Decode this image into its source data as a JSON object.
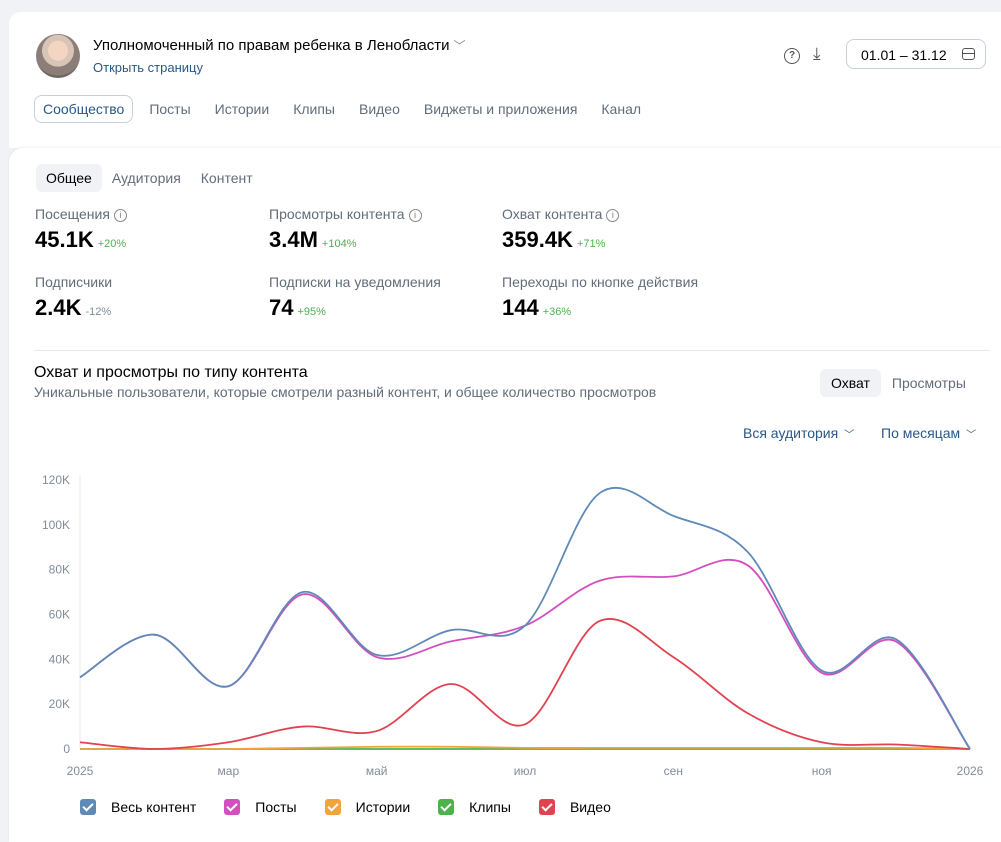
{
  "header": {
    "page_title": "Уполномоченный по правам ребенка в Ленобласти",
    "open_page": "Открыть страницу",
    "date_range": "01.01 – 31.12"
  },
  "tabs": [
    "Сообщество",
    "Посты",
    "Истории",
    "Клипы",
    "Видео",
    "Виджеты и приложения",
    "Канал"
  ],
  "subtabs": [
    "Общее",
    "Аудитория",
    "Контент"
  ],
  "metrics": [
    {
      "label": "Посещения",
      "value": "45.1K",
      "change": "+20%"
    },
    {
      "label": "Просмотры контента",
      "value": "3.4M",
      "change": "+104%"
    },
    {
      "label": "Охват контента",
      "value": "359.4K",
      "change": "+71%"
    },
    {
      "label": "Подписчики",
      "value": "2.4K",
      "change": "-12%"
    },
    {
      "label": "Подписки на уведомления",
      "value": "74",
      "change": "+95%"
    },
    {
      "label": "Переходы по кнопке действия",
      "value": "144",
      "change": "+36%"
    }
  ],
  "chart_section": {
    "title": "Охват и просмотры по типу контента",
    "subtitle": "Уникальные пользователи, которые смотрели разный контент, и общее количество просмотров",
    "toggle": [
      "Охват",
      "Просмотры"
    ],
    "audience_filter": "Вся аудитория",
    "period_filter": "По месяцам"
  },
  "legend": [
    "Весь контент",
    "Посты",
    "Истории",
    "Клипы",
    "Видео"
  ],
  "colors": {
    "all": "#5f8ab8",
    "posts": "#d34fc0",
    "stories": "#f2a33a",
    "clips": "#4bb34b",
    "video": "#e0424f",
    "accent": "#2a5885"
  },
  "chart_data": {
    "type": "line",
    "x": [
      "2025-01-01",
      "2025-02-01",
      "2025-03-01",
      "2025-04-01",
      "2025-05-01",
      "2025-06-01",
      "2025-07-01",
      "2025-08-01",
      "2025-09-01",
      "2025-10-01",
      "2025-11-01",
      "2025-12-01",
      "2026-01-01"
    ],
    "x_tick_labels": [
      "2025",
      "мар",
      "май",
      "июл",
      "сен",
      "ноя",
      "2026"
    ],
    "y_tick_labels": [
      "0",
      "20K",
      "40K",
      "60K",
      "80K",
      "100K",
      "120K"
    ],
    "ylim": [
      0,
      120000
    ],
    "series": [
      {
        "name": "Весь контент",
        "values": [
          32000,
          51000,
          28000,
          70000,
          42000,
          53000,
          55000,
          114000,
          104000,
          88000,
          35000,
          49000,
          0
        ]
      },
      {
        "name": "Посты",
        "values": [
          32000,
          51000,
          28000,
          69000,
          41000,
          48000,
          55000,
          75000,
          77000,
          82000,
          34000,
          48000,
          0
        ]
      },
      {
        "name": "Истории",
        "values": [
          0,
          0,
          0,
          500,
          1000,
          1000,
          500,
          500,
          500,
          500,
          500,
          500,
          0
        ]
      },
      {
        "name": "Клипы",
        "values": [
          0,
          0,
          0,
          0,
          0,
          0,
          0,
          0,
          0,
          0,
          0,
          0,
          0
        ]
      },
      {
        "name": "Видео",
        "values": [
          3000,
          0,
          3000,
          10000,
          8000,
          29000,
          11000,
          57000,
          41000,
          16000,
          3000,
          2000,
          0
        ]
      }
    ]
  }
}
